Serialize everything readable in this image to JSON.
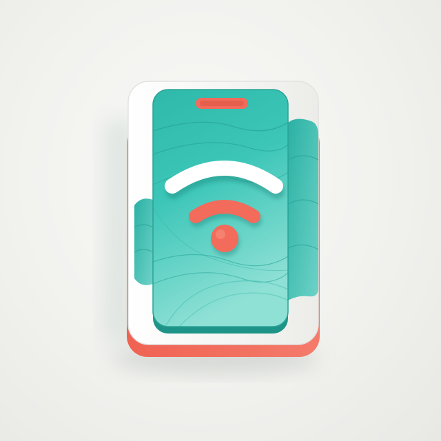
{
  "illustration": {
    "subject": "phone-wifi-icon",
    "colors": {
      "background": "#f2f2ef",
      "teal": "#3cc2b4",
      "teal_dark": "#1f9f95",
      "teal_light": "#7ddbd0",
      "coral": "#f26b5b",
      "base_white": "#fbfbf9"
    },
    "wifi": {
      "bars_total": 3,
      "bars_shown": 3
    }
  }
}
